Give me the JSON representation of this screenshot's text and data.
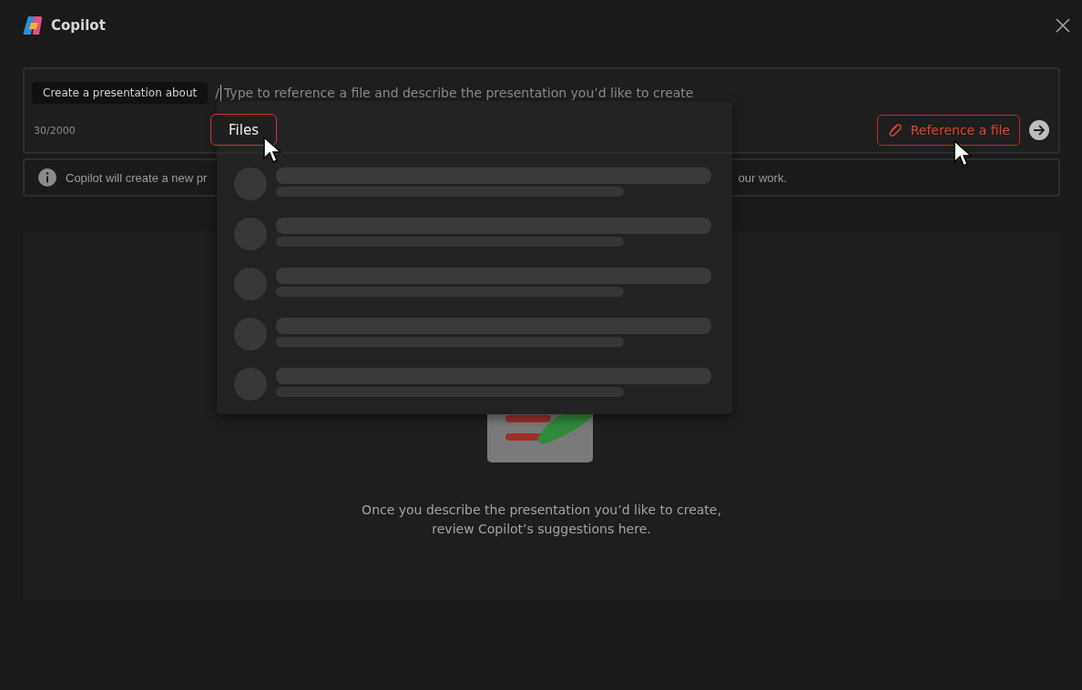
{
  "window": {
    "title": "Copilot"
  },
  "prompt": {
    "chip": "Create a presentation about",
    "typed": "/",
    "placeholder": "Type to reference a file and describe the presentation you’d like to create",
    "counter": "30/2000"
  },
  "reference_button": {
    "label": "Reference a file"
  },
  "popup": {
    "tabs": [
      {
        "label": "Files",
        "selected": true
      }
    ],
    "rows": [
      {
        "kind": "skeleton"
      },
      {
        "kind": "skeleton"
      },
      {
        "kind": "skeleton"
      },
      {
        "kind": "skeleton"
      },
      {
        "kind": "skeleton"
      }
    ]
  },
  "info": {
    "text_start": "Copilot will create a new pr",
    "text_end": "our work."
  },
  "empty_state": {
    "lines": [
      "Once you describe the presentation you’d like to create,",
      "review Copilot’s suggestions here."
    ]
  }
}
